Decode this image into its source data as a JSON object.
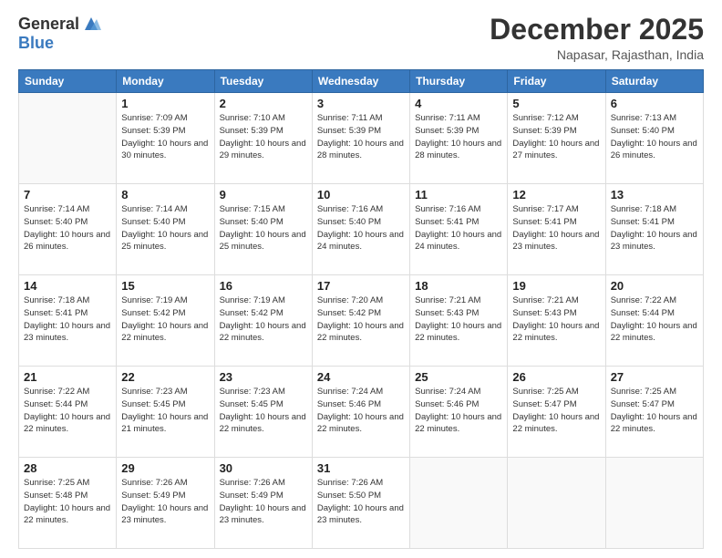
{
  "header": {
    "logo_general": "General",
    "logo_blue": "Blue",
    "title": "December 2025",
    "location": "Napasar, Rajasthan, India"
  },
  "days_of_week": [
    "Sunday",
    "Monday",
    "Tuesday",
    "Wednesday",
    "Thursday",
    "Friday",
    "Saturday"
  ],
  "weeks": [
    [
      {
        "day": "",
        "info": ""
      },
      {
        "day": "1",
        "info": "Sunrise: 7:09 AM\nSunset: 5:39 PM\nDaylight: 10 hours\nand 30 minutes."
      },
      {
        "day": "2",
        "info": "Sunrise: 7:10 AM\nSunset: 5:39 PM\nDaylight: 10 hours\nand 29 minutes."
      },
      {
        "day": "3",
        "info": "Sunrise: 7:11 AM\nSunset: 5:39 PM\nDaylight: 10 hours\nand 28 minutes."
      },
      {
        "day": "4",
        "info": "Sunrise: 7:11 AM\nSunset: 5:39 PM\nDaylight: 10 hours\nand 28 minutes."
      },
      {
        "day": "5",
        "info": "Sunrise: 7:12 AM\nSunset: 5:39 PM\nDaylight: 10 hours\nand 27 minutes."
      },
      {
        "day": "6",
        "info": "Sunrise: 7:13 AM\nSunset: 5:40 PM\nDaylight: 10 hours\nand 26 minutes."
      }
    ],
    [
      {
        "day": "7",
        "info": "Sunrise: 7:14 AM\nSunset: 5:40 PM\nDaylight: 10 hours\nand 26 minutes."
      },
      {
        "day": "8",
        "info": "Sunrise: 7:14 AM\nSunset: 5:40 PM\nDaylight: 10 hours\nand 25 minutes."
      },
      {
        "day": "9",
        "info": "Sunrise: 7:15 AM\nSunset: 5:40 PM\nDaylight: 10 hours\nand 25 minutes."
      },
      {
        "day": "10",
        "info": "Sunrise: 7:16 AM\nSunset: 5:40 PM\nDaylight: 10 hours\nand 24 minutes."
      },
      {
        "day": "11",
        "info": "Sunrise: 7:16 AM\nSunset: 5:41 PM\nDaylight: 10 hours\nand 24 minutes."
      },
      {
        "day": "12",
        "info": "Sunrise: 7:17 AM\nSunset: 5:41 PM\nDaylight: 10 hours\nand 23 minutes."
      },
      {
        "day": "13",
        "info": "Sunrise: 7:18 AM\nSunset: 5:41 PM\nDaylight: 10 hours\nand 23 minutes."
      }
    ],
    [
      {
        "day": "14",
        "info": "Sunrise: 7:18 AM\nSunset: 5:41 PM\nDaylight: 10 hours\nand 23 minutes."
      },
      {
        "day": "15",
        "info": "Sunrise: 7:19 AM\nSunset: 5:42 PM\nDaylight: 10 hours\nand 22 minutes."
      },
      {
        "day": "16",
        "info": "Sunrise: 7:19 AM\nSunset: 5:42 PM\nDaylight: 10 hours\nand 22 minutes."
      },
      {
        "day": "17",
        "info": "Sunrise: 7:20 AM\nSunset: 5:42 PM\nDaylight: 10 hours\nand 22 minutes."
      },
      {
        "day": "18",
        "info": "Sunrise: 7:21 AM\nSunset: 5:43 PM\nDaylight: 10 hours\nand 22 minutes."
      },
      {
        "day": "19",
        "info": "Sunrise: 7:21 AM\nSunset: 5:43 PM\nDaylight: 10 hours\nand 22 minutes."
      },
      {
        "day": "20",
        "info": "Sunrise: 7:22 AM\nSunset: 5:44 PM\nDaylight: 10 hours\nand 22 minutes."
      }
    ],
    [
      {
        "day": "21",
        "info": "Sunrise: 7:22 AM\nSunset: 5:44 PM\nDaylight: 10 hours\nand 22 minutes."
      },
      {
        "day": "22",
        "info": "Sunrise: 7:23 AM\nSunset: 5:45 PM\nDaylight: 10 hours\nand 21 minutes."
      },
      {
        "day": "23",
        "info": "Sunrise: 7:23 AM\nSunset: 5:45 PM\nDaylight: 10 hours\nand 22 minutes."
      },
      {
        "day": "24",
        "info": "Sunrise: 7:24 AM\nSunset: 5:46 PM\nDaylight: 10 hours\nand 22 minutes."
      },
      {
        "day": "25",
        "info": "Sunrise: 7:24 AM\nSunset: 5:46 PM\nDaylight: 10 hours\nand 22 minutes."
      },
      {
        "day": "26",
        "info": "Sunrise: 7:25 AM\nSunset: 5:47 PM\nDaylight: 10 hours\nand 22 minutes."
      },
      {
        "day": "27",
        "info": "Sunrise: 7:25 AM\nSunset: 5:47 PM\nDaylight: 10 hours\nand 22 minutes."
      }
    ],
    [
      {
        "day": "28",
        "info": "Sunrise: 7:25 AM\nSunset: 5:48 PM\nDaylight: 10 hours\nand 22 minutes."
      },
      {
        "day": "29",
        "info": "Sunrise: 7:26 AM\nSunset: 5:49 PM\nDaylight: 10 hours\nand 23 minutes."
      },
      {
        "day": "30",
        "info": "Sunrise: 7:26 AM\nSunset: 5:49 PM\nDaylight: 10 hours\nand 23 minutes."
      },
      {
        "day": "31",
        "info": "Sunrise: 7:26 AM\nSunset: 5:50 PM\nDaylight: 10 hours\nand 23 minutes."
      },
      {
        "day": "",
        "info": ""
      },
      {
        "day": "",
        "info": ""
      },
      {
        "day": "",
        "info": ""
      }
    ]
  ]
}
